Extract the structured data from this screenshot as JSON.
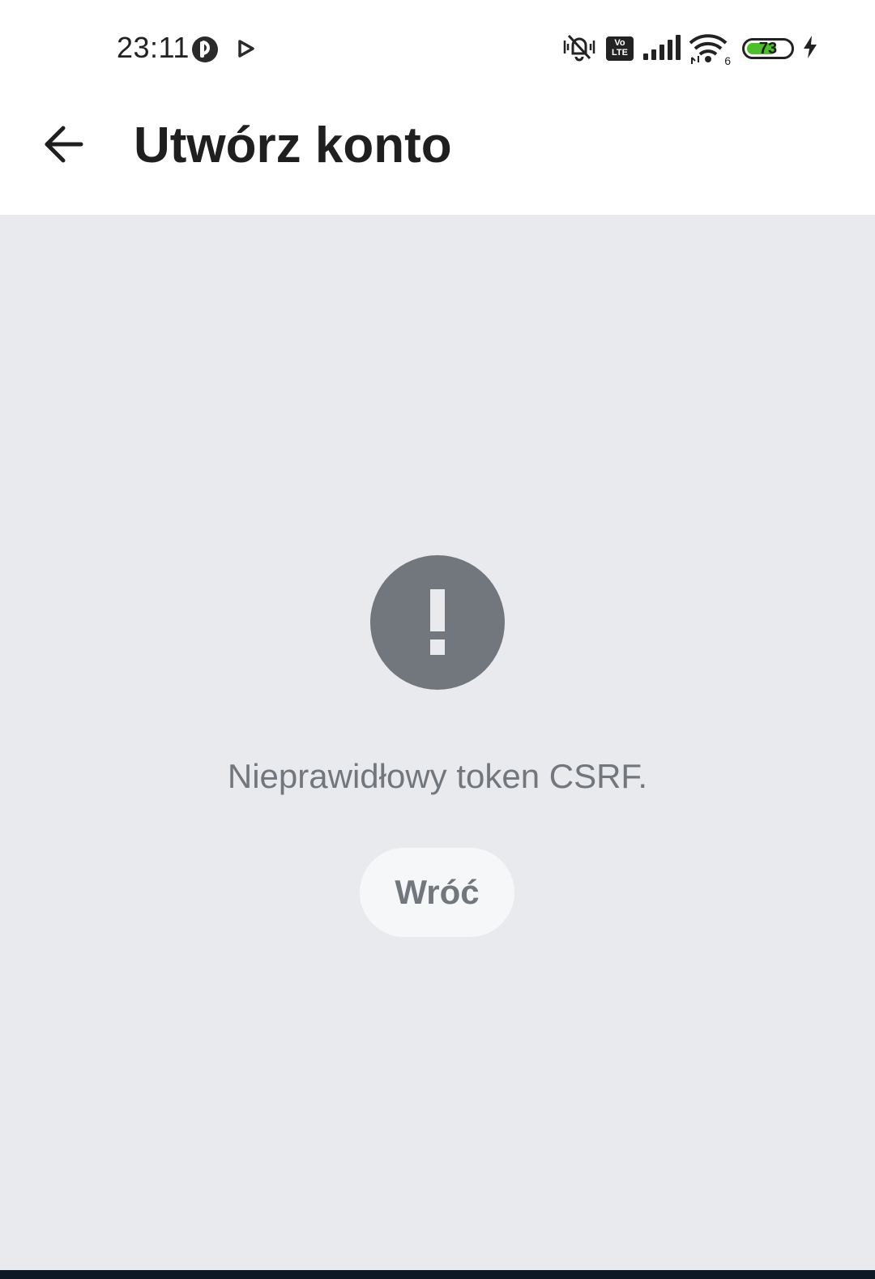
{
  "status_bar": {
    "time": "23:11",
    "battery_level": "73",
    "wifi_label": "6",
    "volte_label_top": "Vo",
    "volte_label_bottom": "LTE",
    "icons": [
      "pinterest-icon",
      "play-icon",
      "silent-bell-icon",
      "volte-icon",
      "signal-icon",
      "wifi-icon",
      "battery-icon",
      "charging-icon"
    ]
  },
  "app_bar": {
    "title": "Utwórz konto",
    "back_icon": "arrow-left-icon"
  },
  "error": {
    "icon": "exclamation-icon",
    "message": "Nieprawidłowy token CSRF.",
    "button_label": "Wróć"
  },
  "colors": {
    "background": "#e9eaee",
    "surface": "#ffffff",
    "muted": "#72777e",
    "battery_fill": "#4cbf2a"
  }
}
